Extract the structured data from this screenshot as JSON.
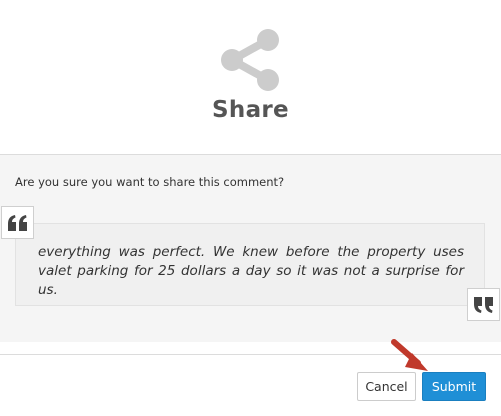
{
  "dialog": {
    "title": "Share",
    "icon": "share-icon",
    "question": "Are you sure you want to share this comment?",
    "comment": "everything was perfect. We knew before the property uses valet parking for 25 dollars a day so it was not a surprise for us.",
    "buttons": {
      "cancel_label": "Cancel",
      "submit_label": "Submit"
    }
  },
  "colors": {
    "icon_gray": "#cccccc",
    "submit_blue": "#1f8fd6",
    "annotation_arrow": "#c0392b"
  }
}
